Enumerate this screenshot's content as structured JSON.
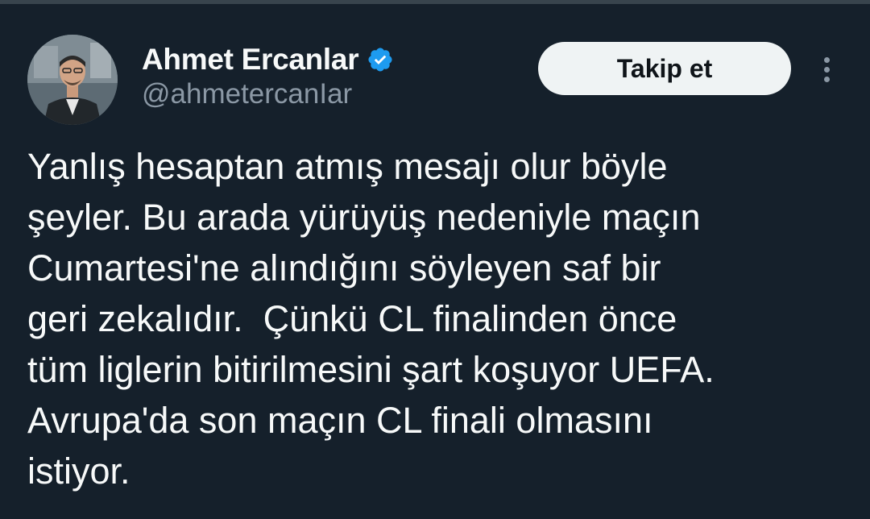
{
  "author": {
    "display_name": "Ahmet Ercanlar",
    "handle": "@ahmetercanIar",
    "verified": true,
    "avatar_icon": "profile-photo-icon"
  },
  "actions": {
    "follow_label": "Takip et",
    "more_icon": "more-options-icon"
  },
  "tweet": {
    "lines": [
      "Yanlış hesaptan atmış mesajı olur böyle",
      "şeyler. Bu arada yürüyüş nedeniyle maçın",
      "Cumartesi'ne alındığını söyleyen saf bir",
      "geri zekalıdır.  Çünkü CL finalinden önce",
      "tüm liglerin bitirilmesini şart koşuyor UEFA.",
      "Avrupa'da son maçın CL finali olmasını",
      "istiyor."
    ]
  },
  "colors": {
    "background": "#15202b",
    "text": "#f7f9f9",
    "secondary_text": "#8b98a5",
    "verified_badge": "#1d9bf0",
    "follow_button_bg": "#eff3f4",
    "follow_button_text": "#0f1419"
  }
}
